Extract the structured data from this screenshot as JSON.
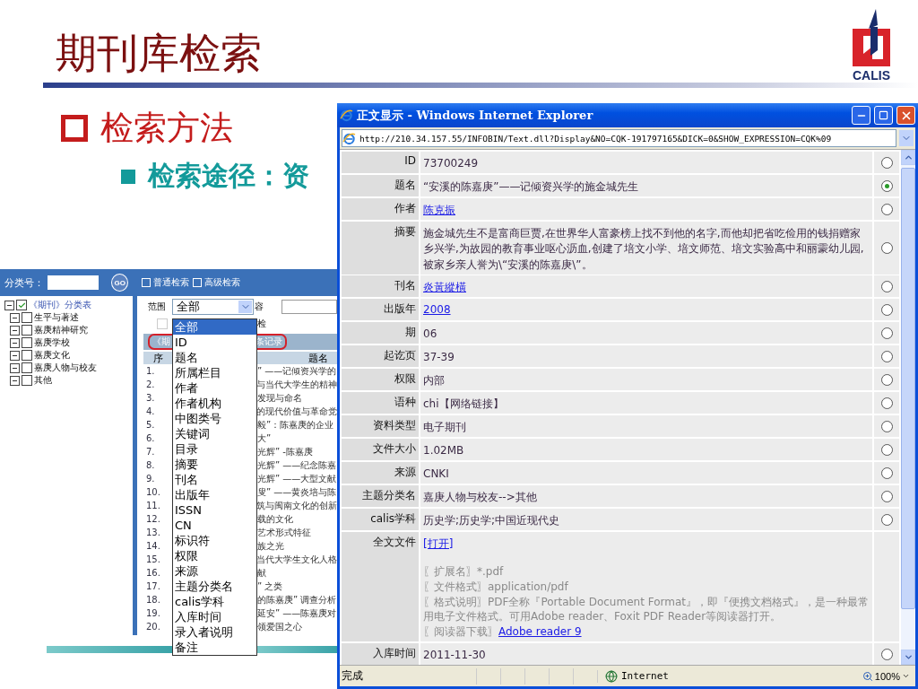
{
  "slide": {
    "title": "期刊库检索",
    "logo": {
      "text": "CALIS"
    },
    "bullets": [
      {
        "kind": "main",
        "text": "检索方法"
      },
      {
        "kind": "sub",
        "text": "检索途径：资"
      }
    ]
  },
  "back_screen": {
    "class_search": {
      "label": "分类号：",
      "button": "GO"
    },
    "tree": {
      "label": "《期刊》分类表",
      "checked": true,
      "expanded": true,
      "children": [
        {
          "label": "生平与著述",
          "checked": false,
          "expanded": true
        },
        {
          "label": "嘉庚精神研究",
          "checked": false,
          "expanded": true
        },
        {
          "label": "嘉庚学校",
          "checked": false,
          "expanded": true
        },
        {
          "label": "嘉庚文化",
          "checked": false,
          "expanded": true
        },
        {
          "label": "嘉庚人物与校友",
          "checked": false,
          "expanded": true
        },
        {
          "label": "其他",
          "checked": false,
          "expanded": true
        }
      ]
    },
    "tabs": [
      {
        "label": "普通检索"
      },
      {
        "label": "高级检索"
      }
    ],
    "scope": {
      "label": "范围",
      "value": "全部",
      "expanded": true,
      "options": [
        {
          "label": "全部",
          "selected": true
        },
        {
          "label": "ID",
          "selected": false
        },
        {
          "label": "题名",
          "selected": false
        },
        {
          "label": "所属栏目",
          "selected": false
        },
        {
          "label": "作者",
          "selected": false
        },
        {
          "label": "作者机构",
          "selected": false
        },
        {
          "label": "中图类号",
          "selected": false
        },
        {
          "label": "关键词",
          "selected": false
        },
        {
          "label": "目录",
          "selected": false
        },
        {
          "label": "摘要",
          "selected": false
        },
        {
          "label": "刊名",
          "selected": false
        },
        {
          "label": "出版年",
          "selected": false
        },
        {
          "label": "ISSN",
          "selected": false
        },
        {
          "label": "CN",
          "selected": false
        },
        {
          "label": "标识符",
          "selected": false
        },
        {
          "label": "权限",
          "selected": false
        },
        {
          "label": "来源",
          "selected": false
        },
        {
          "label": "主题分类名",
          "selected": false
        },
        {
          "label": "calis学科",
          "selected": false
        },
        {
          "label": "入库时间",
          "selected": false
        },
        {
          "label": "录入者说明",
          "selected": false
        },
        {
          "label": "备注",
          "selected": false
        }
      ]
    },
    "content_label": "容",
    "option": {
      "label": "检",
      "checked": false
    },
    "result_bar": {
      "left": "《期",
      "right": "条记录"
    },
    "columns": [
      "序",
      "题名"
    ],
    "rows": [
      {
        "number": "1.",
        "title": "” ——记倾资兴学的"
      },
      {
        "number": "2.",
        "title": "与当代大学生的精神"
      },
      {
        "number": "3.",
        "title": "发现与命名"
      },
      {
        "number": "4.",
        "title": "的现代价值与革命党"
      },
      {
        "number": "5.",
        "title": "毅”：陈嘉庚的企业"
      },
      {
        "number": "6.",
        "title": "大”"
      },
      {
        "number": "7.",
        "title": "光辉” -陈嘉庚"
      },
      {
        "number": "8.",
        "title": "光辉” ——纪念陈嘉"
      },
      {
        "number": "9.",
        "title": "光辉” ——大型文献"
      },
      {
        "number": "10.",
        "title": "叟” ——黄炎培与陈"
      },
      {
        "number": "11.",
        "title": "筑与闽南文化的创新"
      },
      {
        "number": "12.",
        "title": "载的文化"
      },
      {
        "number": "13.",
        "title": "艺术形式特征"
      },
      {
        "number": "14.",
        "title": "族之光"
      },
      {
        "number": "15.",
        "title": "当代大学生文化人格"
      },
      {
        "number": "16.",
        "title": "献"
      },
      {
        "number": "17.",
        "title": "” 之类"
      },
      {
        "number": "18.",
        "title": "的陈嘉庚” 调查分析"
      },
      {
        "number": "19.",
        "title": "延安” ——陈嘉庚对"
      },
      {
        "number": "20.",
        "title": "领爱国之心"
      }
    ]
  },
  "ie_window": {
    "title": "正文显示 - Windows Internet Explorer",
    "address": "http://210.34.157.55/INFOBIN/Text.dll?Display&NO=CQK-191797165&DICK=0&SHOW_EXPRESSION=CQK%09",
    "fields": [
      {
        "label": "ID",
        "value": "73700249",
        "kind": "text",
        "selected": false
      },
      {
        "label": "题名",
        "value": "“安溪的陈嘉庚”——记倾资兴学的施金城先生",
        "kind": "text",
        "selected": true
      },
      {
        "label": "作者",
        "value": "陈克振",
        "kind": "link",
        "selected": false
      },
      {
        "label": "摘要",
        "value": "施金城先生不是富商巨贾,在世界华人富豪榜上找不到他的名字,而他却把省吃俭用的钱捐赠家乡兴学,为故园的教育事业呕心沥血,创建了培文小学、培文师范、培文实验高中和丽霥幼儿园,被家乡亲人誉为\\“安溪的陈嘉庚\\”。",
        "kind": "text",
        "selected": false
      },
      {
        "label": "刊名",
        "value": "炎黃縱橫",
        "kind": "link",
        "selected": false
      },
      {
        "label": "出版年",
        "value": "2008",
        "kind": "link",
        "selected": false
      },
      {
        "label": "期",
        "value": "06",
        "kind": "text",
        "selected": false
      },
      {
        "label": "起讫页",
        "value": "37-39",
        "kind": "text",
        "selected": false
      },
      {
        "label": "权限",
        "value": "内部",
        "kind": "text",
        "selected": false
      },
      {
        "label": "语种",
        "value": "chi【网络链接】",
        "kind": "text",
        "selected": false
      },
      {
        "label": "资料类型",
        "value": "电子期刊",
        "kind": "text",
        "selected": false
      },
      {
        "label": "文件大小",
        "value": "1.02MB",
        "kind": "text",
        "selected": false
      },
      {
        "label": "来源",
        "value": "CNKI",
        "kind": "text",
        "selected": false
      },
      {
        "label": "主题分类名",
        "value": "嘉庚人物与校友-->其他",
        "kind": "text",
        "selected": false
      },
      {
        "label": "calis学科",
        "value": "历史学;历史学;中国近现代史",
        "kind": "text",
        "selected": false
      },
      {
        "label": "全文文件",
        "kind": "file",
        "link": "[打开]",
        "notes": [
          "〖扩展名〗*.pdf",
          "〖文件格式〗application/pdf",
          "〖格式说明〗PDF全称『Portable Document Format』，即『便携文档格式』，是一种最常用电子文件格式。可用Adobe reader、Foxit PDF Reader等阅读器打开。"
        ],
        "download": {
          "label": "〖阅读器下载〗",
          "link": "Adobe reader 9"
        }
      },
      {
        "label": "入库时间",
        "value": "2011-11-30",
        "kind": "text",
        "selected": false
      }
    ],
    "status": {
      "text": "完成",
      "zone": "Internet",
      "zoom": "100%"
    }
  }
}
